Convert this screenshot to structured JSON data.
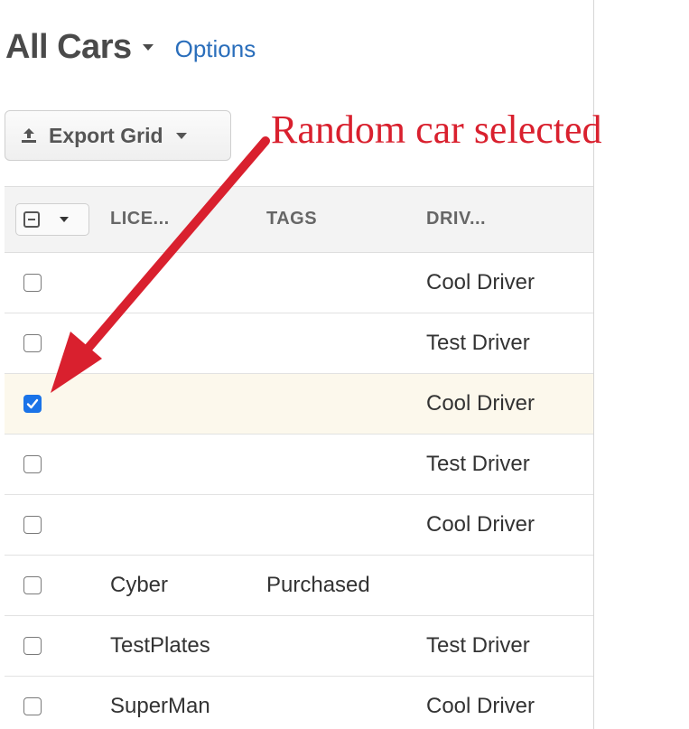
{
  "header": {
    "title": "All Cars",
    "options_label": "Options"
  },
  "toolbar": {
    "export_label": "Export Grid"
  },
  "grid": {
    "columns": [
      "LICE...",
      "TAGS",
      "DRIV..."
    ],
    "rows": [
      {
        "checked": false,
        "license": "",
        "tags": "",
        "driver": "Cool Driver"
      },
      {
        "checked": false,
        "license": "",
        "tags": "",
        "driver": "Test Driver"
      },
      {
        "checked": true,
        "license": "",
        "tags": "",
        "driver": "Cool Driver"
      },
      {
        "checked": false,
        "license": "",
        "tags": "",
        "driver": "Test Driver"
      },
      {
        "checked": false,
        "license": "",
        "tags": "",
        "driver": "Cool Driver"
      },
      {
        "checked": false,
        "license": "Cyber",
        "tags": "Purchased",
        "driver": ""
      },
      {
        "checked": false,
        "license": "TestPlates",
        "tags": "",
        "driver": "Test Driver"
      },
      {
        "checked": false,
        "license": "SuperMan",
        "tags": "",
        "driver": "Cool Driver"
      }
    ]
  },
  "annotation": {
    "text": "Random car selected",
    "color": "#d9202e"
  },
  "colors": {
    "link": "#2a6ebb",
    "checkbox_checked": "#1a73e8",
    "selected_row": "#fcf8ec"
  },
  "icons": {
    "export": "upload-icon",
    "select_all": "minus-checkbox-icon"
  }
}
